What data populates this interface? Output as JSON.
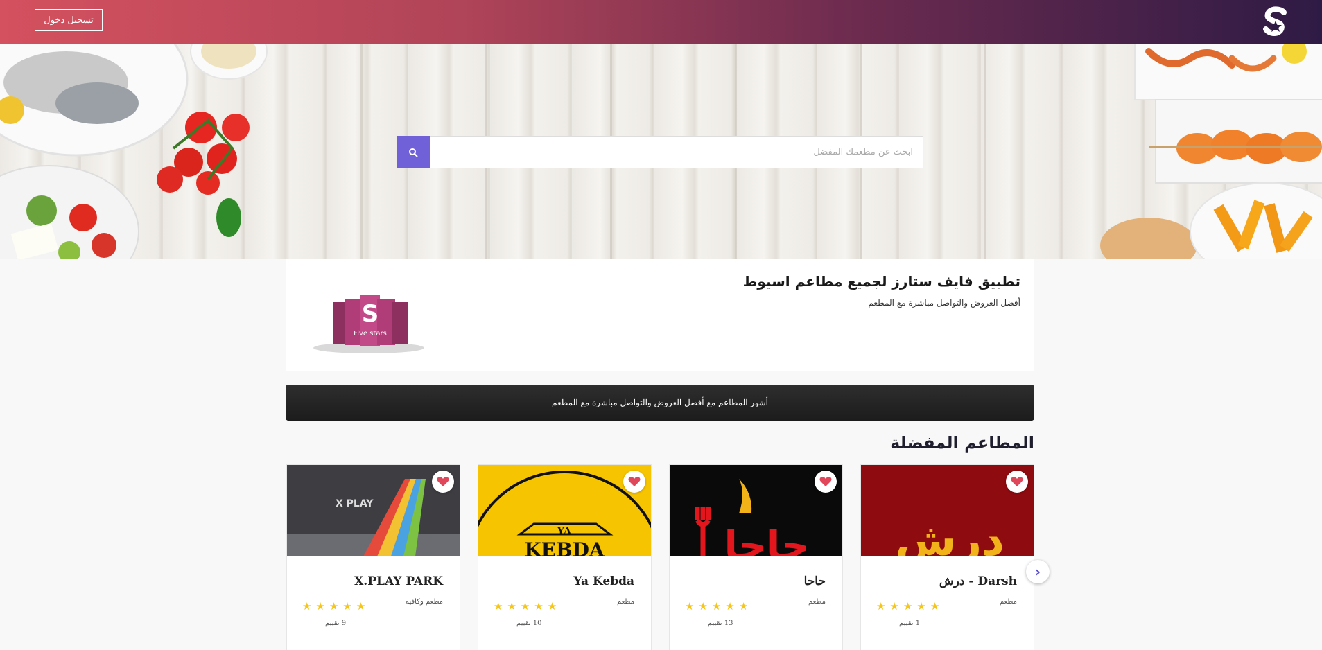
{
  "header": {
    "login_label": "تسجيل دخول",
    "logo_icon": "fivestars-logo-icon"
  },
  "search": {
    "placeholder": "ابحث عن مطعمك المفضل",
    "button_icon": "search-icon"
  },
  "intro": {
    "title": "تطبيق فايف ستارز لجميع مطاعم اسيوط",
    "subtitle": "أفضل العروض والتواصل مباشرة مع المطعم",
    "logo_text": "Five stars"
  },
  "banner": {
    "text": "أشهر المطاعم مع أفضل العروض والتواصل مباشرة مع المطعم"
  },
  "favorites": {
    "title": "المطاعم المفضلة",
    "next_icon": "chevron-right-icon",
    "cards": [
      {
        "name": "Darsh - درش",
        "category": "مطعم",
        "stars": 5,
        "rating_count": "1 تقييم",
        "image_text": "درش",
        "bg": "#8e0b10"
      },
      {
        "name": "حاحا",
        "category": "مطعم",
        "stars": 5,
        "rating_count": "13 تقييم",
        "image_text": "حاحا",
        "bg": "#0a0a0a"
      },
      {
        "name": "Ya Kebda",
        "category": "مطعم",
        "stars": 5,
        "rating_count": "10 تقييم",
        "image_text": "KEBDA",
        "bg": "#f6c400"
      },
      {
        "name": "X.PLAY PARK",
        "category": "مطعم وكافيه",
        "stars": 5,
        "rating_count": "9 تقييم",
        "image_text": "X PLAY",
        "bg": "#4a4a4f"
      }
    ]
  },
  "colors": {
    "accent": "#7161d9",
    "header_start": "#d4515f",
    "header_end": "#2e1b45",
    "heart": "#e0475a",
    "star": "#f5c518"
  }
}
